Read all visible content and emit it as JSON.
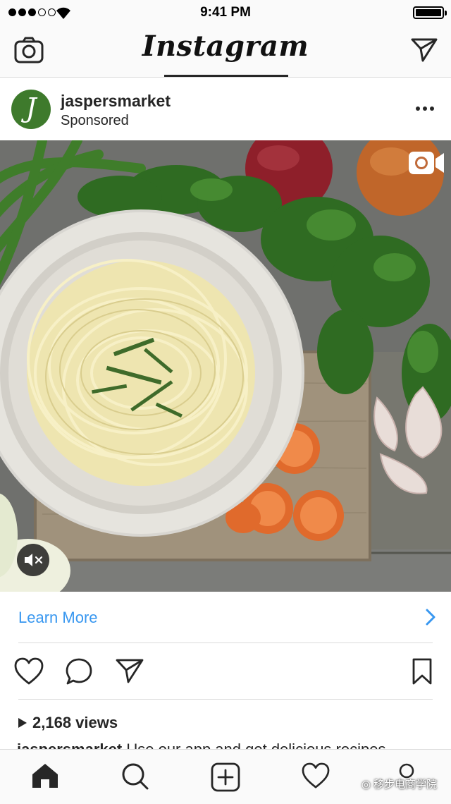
{
  "status_bar": {
    "time": "9:41 PM",
    "signal_bars_filled": 3,
    "signal_bars_total": 5,
    "battery_level": 0.95
  },
  "nav": {
    "logo_text": "Instagram",
    "left_icon": "camera-icon",
    "right_icon": "direct-send-icon"
  },
  "post": {
    "username": "jaspersmarket",
    "subtitle": "Sponsored",
    "avatar_letter": "J",
    "avatar_color": "#3e7a2c",
    "media_type": "video",
    "media_description_icon": "video-camera-icon",
    "mute_icon": "speaker-muted-icon",
    "cta_label": "Learn More",
    "cta_color": "#3897f0",
    "views_text": "2,168 views",
    "caption_user": "jaspersmarket",
    "caption_text": "Use our app and get delicious recipes"
  },
  "actions": {
    "like_icon": "heart-icon",
    "comment_icon": "comment-icon",
    "share_icon": "send-icon",
    "save_icon": "bookmark-icon"
  },
  "tabbar": {
    "items": [
      {
        "icon": "home-icon"
      },
      {
        "icon": "search-icon"
      },
      {
        "icon": "add-post-icon"
      },
      {
        "icon": "activity-heart-icon"
      },
      {
        "icon": "profile-icon"
      }
    ],
    "watermark_text": "移步电商学院"
  }
}
